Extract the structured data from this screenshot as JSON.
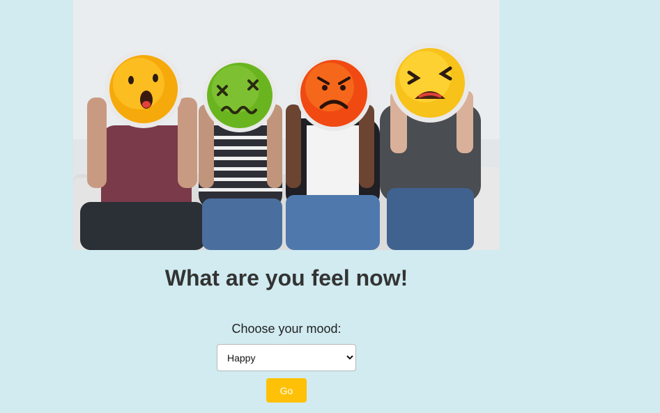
{
  "hero": {
    "alt_icon": "people-holding-emoji-faces-photo"
  },
  "heading": "What are you feel now!",
  "mood": {
    "label": "Choose your mood:",
    "selected": "Happy",
    "options": [
      "Happy"
    ]
  },
  "go_button": "Go",
  "colors": {
    "background": "#d1ebf0",
    "button": "#ffc107",
    "heading": "#333333"
  }
}
